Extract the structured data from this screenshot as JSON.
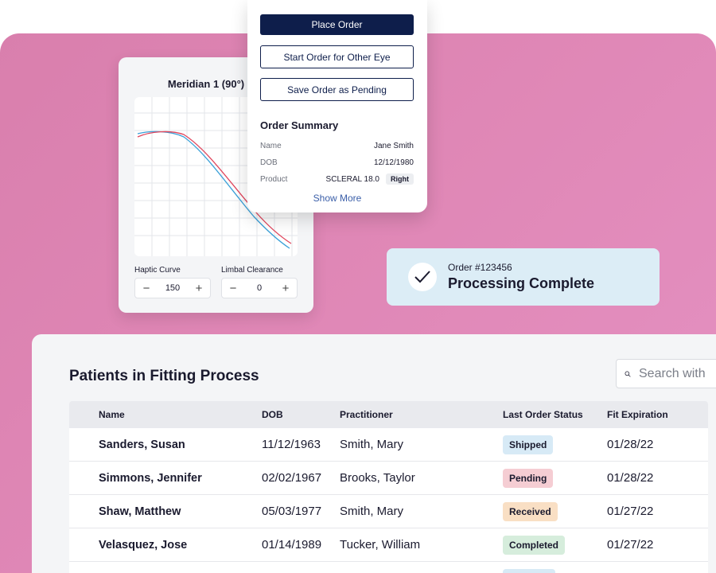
{
  "lens_card": {
    "title": "Meridian 1 (90°)",
    "haptic_label": "Haptic Curve",
    "haptic_value": "150",
    "limbal_label": "Limbal Clearance",
    "limbal_value": "0",
    "minus": "−",
    "plus": "+",
    "curve_colors": [
      "#e0455c",
      "#3aa0d8"
    ]
  },
  "order_popup": {
    "place_order": "Place Order",
    "start_other_eye": "Start Order for Other Eye",
    "save_pending": "Save Order as Pending",
    "summary_title": "Order Summary",
    "rows": [
      {
        "key": "Name",
        "value": "Jane Smith"
      },
      {
        "key": "DOB",
        "value": "12/12/1980"
      },
      {
        "key": "Product",
        "value": "SCLERAL 18.0",
        "badge": "Right"
      }
    ],
    "show_more": "Show More"
  },
  "status_toast": {
    "order_number": "Order #123456",
    "message": "Processing Complete"
  },
  "patients": {
    "title": "Patients in Fitting Process",
    "search_placeholder": "Search with",
    "columns": [
      "Name",
      "DOB",
      "Practitioner",
      "Last Order Status",
      "Fit Expiration"
    ],
    "rows": [
      {
        "name": "Sanders, Susan",
        "dob": "11/12/1963",
        "practitioner": "Smith, Mary",
        "status": "Shipped",
        "expiration": "01/28/22"
      },
      {
        "name": "Simmons, Jennifer",
        "dob": "02/02/1967",
        "practitioner": "Brooks, Taylor",
        "status": "Pending",
        "expiration": "01/28/22"
      },
      {
        "name": "Shaw, Matthew",
        "dob": "05/03/1977",
        "practitioner": "Smith, Mary",
        "status": "Received",
        "expiration": "01/27/22"
      },
      {
        "name": "Velasquez, Jose",
        "dob": "01/14/1989",
        "practitioner": "Tucker, William",
        "status": "Completed",
        "expiration": "01/27/22"
      }
    ]
  },
  "colors": {
    "navy": "#0e1e4b",
    "background_pink": "#e088b7",
    "toast_bg": "#dcedf6"
  }
}
